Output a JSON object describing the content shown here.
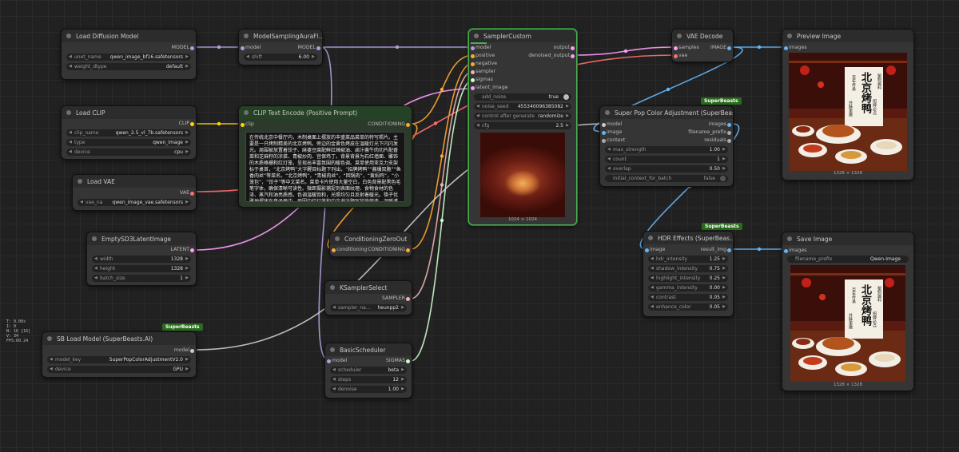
{
  "colors": {
    "model": "#b39ddb",
    "clip": "#ffd500",
    "vae": "#ff6e6e",
    "conditioning": "#ffa931",
    "latent": "#ff9cf9",
    "image": "#64b5f6",
    "sampler": "#ecb4b4",
    "sigmas": "#cdffcd",
    "accent": "#4caf50"
  },
  "stats": {
    "t": "T: 0.00s",
    "i": "I: 0",
    "n": "N: 16 [16]",
    "v": "V: 34",
    "fps": "FPS:60.24"
  },
  "nodes": {
    "load_diffusion": {
      "title": "Load Diffusion Model",
      "out": "MODEL",
      "unet_name": "unet_name",
      "unet_value": "qwen_image_bf16.safetensors",
      "dtype_name": "weight_dtype",
      "dtype_value": "default"
    },
    "model_sampling": {
      "title": "ModelSamplingAuraFl…",
      "in": "model",
      "out": "MODEL",
      "shift_name": "shift",
      "shift_value": "6.00"
    },
    "load_clip": {
      "title": "Load CLIP",
      "out": "CLIP",
      "clip_name": "clip_name",
      "clip_value": "qwen_2.5_vl_7b.safetensors",
      "type_name": "type",
      "type_value": "qwen_image",
      "device_name": "device",
      "device_value": "cpu"
    },
    "clip_text": {
      "title": "CLIP Text Encode (Positive Prompt)",
      "in": "clip",
      "out": "CONDITIONING",
      "prompt": "在传统北京中餐厅内，木制桌面上摆放的丰盛菜品菜单的特写照片。主要是一只烤制精美的北京烤鸭。旁边的金黄色烤皮在温暖灯光下闪闪发光。周围被放置着饺子、麻婆豆腐配鲜红辣椒油、卤汁酱牛肉切片配香菜和芝麻籽的凉菜、青椒炒肉、宫保鸡丁。背景背景为石红墙面、雕饰的木质格栅和红灯笼，呈现出丰富氛围的暖色调。菜单使用亚克力支架标于桌首，“北京烤鸭”大字醒目标题下列出，“招牌烤鸭”“酱爆双脆”“鱼香肉丝”等菜名。“北京烤鸭”，“青椒肉丝”，“回锅肉”，“黄焖鸡”，“小笼包”，“饺子”等中文菜名。菜单卡片使用大量空白，白色背景配黑色毛笔字体，确保清晰可读性。微距摄影捕捉到表面纹理、食物食材的色泽、蒸汽和油亮质感。色调温暖饱和，光照均匀且反射着暖光。筷子优雅地摆放在盘子旁边。周围中红灯笼和中文书法题写装饰营造。温暖诱人的餐厅灯光营造出传统氛围。专业美食摄影、高分辨率、浅景深效果，正宗中式料理美学。"
    },
    "load_vae": {
      "title": "Load VAE",
      "out": "VAE",
      "vae_name": "vae_na",
      "vae_value": "qwen_image_vae.safetensors"
    },
    "empty_latent": {
      "title": "EmptySD3LatentImage",
      "out": "LATENT",
      "width_name": "width",
      "width_value": "1328",
      "height_name": "height",
      "height_value": "1328",
      "batch_name": "batch_size",
      "batch_value": "1"
    },
    "cond_zero": {
      "title": "ConditioningZeroOut",
      "in": "conditioning",
      "out": "CONDITIONING"
    },
    "ksampler_select": {
      "title": "KSamplerSelect",
      "out": "SAMPLER",
      "sampler_name": "sampler_na…",
      "sampler_value": "heunpp2"
    },
    "basic_scheduler": {
      "title": "BasicScheduler",
      "in": "model",
      "out": "SIGMAS",
      "scheduler_name": "scheduler",
      "scheduler_value": "beta",
      "steps_name": "steps",
      "steps_value": "12",
      "denoise_name": "denoise",
      "denoise_value": "1.00"
    },
    "sb_load_model": {
      "title": "SB Load Model (SuperBeasts.AI)",
      "badge": "SuperBeasts",
      "out": "model",
      "key_name": "model_key",
      "key_value": "SuperPopColorAdjustmentV2.0",
      "device_name": "device",
      "device_value": "GPU"
    },
    "sampler_custom": {
      "title": "SamplerCustom",
      "inputs": [
        "model",
        "positive",
        "negative",
        "sampler",
        "sigmas",
        "latent_image"
      ],
      "out_output": "output",
      "out_denoised": "denoised_output",
      "add_noise_name": "add_noise",
      "add_noise_value": "true",
      "seed_name": "noise_seed",
      "seed_value": "455340096385082",
      "control_name": "control after generate",
      "control_value": "randomize",
      "cfg_name": "cfg",
      "cfg_value": "2.5",
      "preview_caption": "1024 × 1024"
    },
    "vae_decode": {
      "title": "VAE Decode",
      "in_samples": "samples",
      "in_vae": "vae",
      "out": "IMAGE"
    },
    "super_pop": {
      "title": "Super Pop Color Adjustment (SuperBeas…",
      "badge": "SuperBeasts",
      "in_model": "model",
      "in_image": "image",
      "in_context": "context",
      "out_images": "images",
      "out_prefix": "filename_prefix",
      "out_residuals": "residuals",
      "strength_name": "max_strength",
      "strength_value": "1.00",
      "count_name": "count",
      "count_value": "1",
      "overlap_name": "overlap",
      "overlap_value": "0.50",
      "initial_name": "initial_context_for_batch",
      "initial_value": "false"
    },
    "hdr_effects": {
      "title": "HDR Effects (SuperBeas…",
      "badge": "SuperBeasts",
      "in": "image",
      "out": "result_img",
      "hdr_name": "hdr_intensity",
      "hdr_value": "1.25",
      "shadow_name": "shadow_intensity",
      "shadow_value": "0.75",
      "highlight_name": "highlight_intensity",
      "highlight_value": "0.25",
      "gamma_name": "gamma_intensity",
      "gamma_value": "0.00",
      "contrast_name": "contrast",
      "contrast_value": "0.05",
      "enhance_name": "enhance_color",
      "enhance_value": "0.05"
    },
    "preview_image": {
      "title": "Preview Image",
      "in": "images",
      "caption": "1328 × 1328"
    },
    "save_image": {
      "title": "Save Image",
      "in": "images",
      "prefix_name": "filename_prefix",
      "prefix_value": "Qwen-Image",
      "caption": "1328 × 1328"
    }
  },
  "image_text": {
    "title": "北京烤鸭",
    "left": "百年传承",
    "left2": "招牌必点",
    "right": "秘制酱料",
    "right2": "外酥里嫩"
  }
}
